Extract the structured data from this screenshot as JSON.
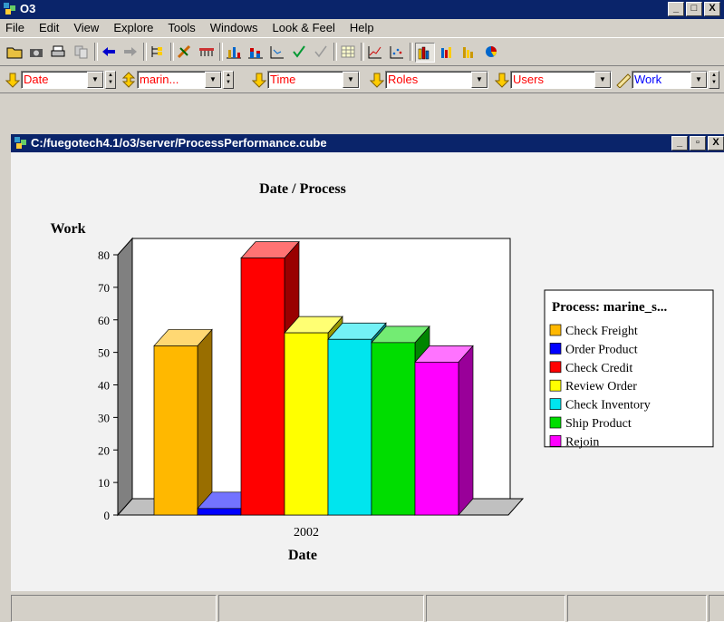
{
  "app": {
    "title": "O3",
    "icon": "o3-app-icon"
  },
  "window_buttons": {
    "minimize": "_",
    "restore": "□",
    "close": "X",
    "maximize": "▫"
  },
  "menu": [
    "File",
    "Edit",
    "View",
    "Explore",
    "Tools",
    "Windows",
    "Look & Feel",
    "Help"
  ],
  "toolbar": {
    "icons": [
      "open-folder-icon",
      "camera-icon",
      "print-icon",
      "copy-icon",
      "back-arrow-icon",
      "forward-arrow-icon",
      "tree-icon",
      "drill-icon",
      "pivot-icon",
      "bar-chart-icon",
      "stacked-bar-icon",
      "scatter-icon",
      "check-icon",
      "check-outline-icon",
      "table-icon",
      "line-chart-icon",
      "dot-chart-icon",
      "3d-bar-chart-icon",
      "3d-bar-chart-2-icon",
      "3d-bar-chart-3-icon",
      "pie-chart-icon"
    ]
  },
  "dimensions": [
    {
      "name": "date",
      "value": "Date",
      "color": "#ff0000"
    },
    {
      "name": "process",
      "value": "marin...",
      "color": "#ff0000"
    },
    {
      "name": "time",
      "value": "Time",
      "color": "#ff0000"
    },
    {
      "name": "roles",
      "value": "Roles",
      "color": "#ff0000"
    },
    {
      "name": "users",
      "value": "Users",
      "color": "#ff0000"
    },
    {
      "name": "measure",
      "value": "Work",
      "color": "#0000ff"
    }
  ],
  "inner_window": {
    "title": "C:/fuegotech4.1/o3/server/ProcessPerformance.cube"
  },
  "chart_data": {
    "type": "bar",
    "title": "Date / Process",
    "ylabel": "Work",
    "xlabel": "Date",
    "categories": [
      "2002"
    ],
    "ylim": [
      0,
      80
    ],
    "yticks": [
      0,
      10,
      20,
      30,
      40,
      50,
      60,
      70,
      80
    ],
    "legend_title": "Process: marine_s...",
    "legend_position": "right",
    "series": [
      {
        "name": "Check Freight",
        "values": [
          52
        ],
        "color": "#ffb800"
      },
      {
        "name": "Order Product",
        "values": [
          2
        ],
        "color": "#0000ff"
      },
      {
        "name": "Check Credit",
        "values": [
          79
        ],
        "color": "#ff0000"
      },
      {
        "name": "Review Order",
        "values": [
          56
        ],
        "color": "#ffff00"
      },
      {
        "name": "Check Inventory",
        "values": [
          54
        ],
        "color": "#00e5ee"
      },
      {
        "name": "Ship Product",
        "values": [
          53
        ],
        "color": "#00dd00"
      },
      {
        "name": "Rejoin",
        "values": [
          47
        ],
        "color": "#ff00ff"
      }
    ]
  }
}
